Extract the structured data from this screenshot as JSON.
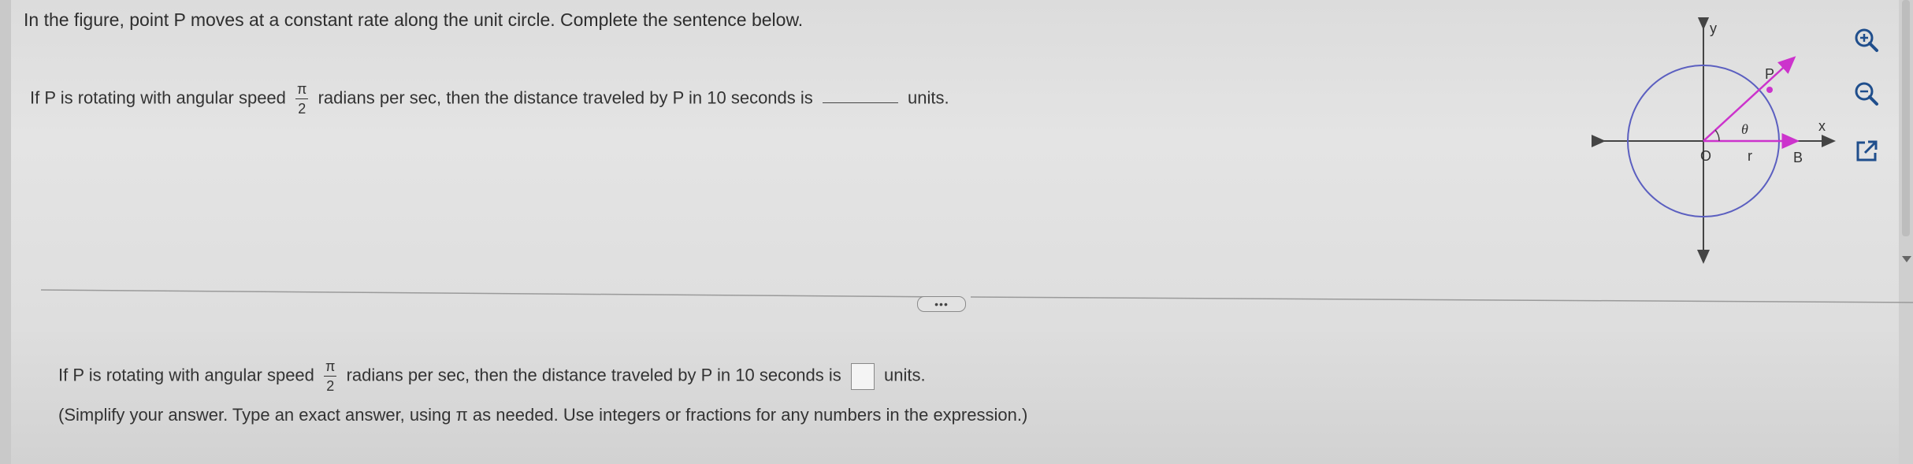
{
  "question": {
    "intro": "In the figure, point P moves at a constant rate along the unit circle. Complete the sentence below.",
    "sentence_prefix": "If P is rotating with angular speed",
    "frac_num": "π",
    "frac_den": "2",
    "sentence_middle": "radians per sec, then the distance traveled by P in 10 seconds is",
    "sentence_suffix": "units."
  },
  "answer": {
    "prefix": "If P is rotating with angular speed",
    "frac_num": "π",
    "frac_den": "2",
    "middle": "radians per sec, then the distance traveled by P in 10 seconds is",
    "suffix": "units.",
    "instructions": "(Simplify your answer. Type an exact answer, using π as needed. Use integers or fractions for any numbers in the expression.)"
  },
  "divider": {
    "more_label": "•••"
  },
  "figure": {
    "label_y": "y",
    "label_x": "x",
    "label_o": "O",
    "label_p": "P",
    "label_b": "B",
    "label_r": "r",
    "label_theta": "θ",
    "circle_color": "#5b5fc0",
    "vector_color": "#cc33cc"
  },
  "tools": {
    "zoom_in_icon": "zoom-in-icon",
    "zoom_out_icon": "zoom-out-icon",
    "popout_icon": "popout-icon",
    "icon_color": "#1f4e8c"
  }
}
